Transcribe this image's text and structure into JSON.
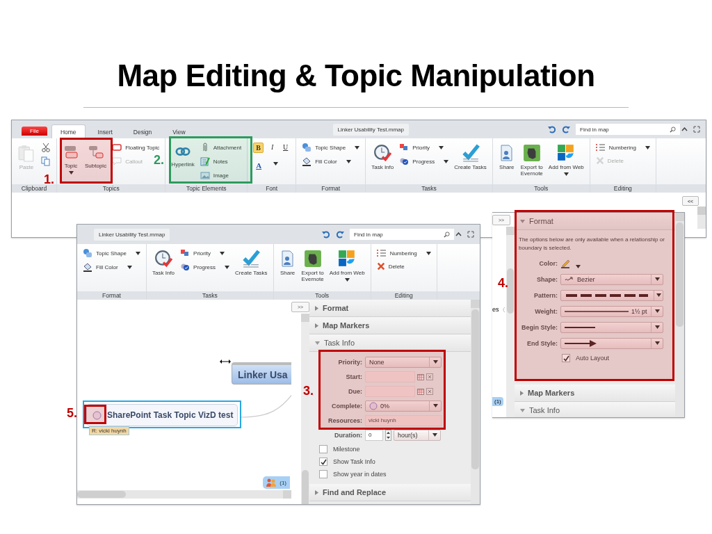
{
  "title": "Map Editing & Topic Manipulation",
  "ribbon_window": {
    "tabs": [
      {
        "label": "File",
        "kind": "file",
        "selected": false
      },
      {
        "label": "Home",
        "kind": "tab",
        "selected": true
      },
      {
        "label": "Insert",
        "kind": "tab",
        "selected": false
      },
      {
        "label": "Design",
        "kind": "tab",
        "selected": false
      },
      {
        "label": "View",
        "kind": "tab",
        "selected": false
      }
    ],
    "document_tab": "Linker Usability Test.mmap",
    "search": {
      "placeholder": "Find in map"
    },
    "groups": [
      {
        "label": "Clipboard",
        "commands": [
          {
            "kind": "large",
            "label": "Paste",
            "disabled": true
          },
          {
            "kind": "icon"
          },
          {
            "kind": "icon"
          }
        ]
      },
      {
        "label": "Topics",
        "commands": [
          {
            "kind": "large",
            "label": "Topic",
            "dropdown": true
          },
          {
            "kind": "large",
            "label": "Subtopic"
          },
          {
            "kind": "small",
            "label": "Floating Topic"
          },
          {
            "kind": "small",
            "label": "Callout",
            "disabled": true
          }
        ]
      },
      {
        "label": "Topic Elements",
        "commands": [
          {
            "kind": "large",
            "label": "Hyperlink"
          },
          {
            "kind": "small",
            "label": "Attachment"
          },
          {
            "kind": "small",
            "label": "Notes"
          },
          {
            "kind": "small",
            "label": "Image"
          }
        ]
      },
      {
        "label": "Font",
        "commands": [
          {
            "kind": "toggle",
            "label": "B",
            "on": true
          },
          {
            "kind": "toggle",
            "label": "I",
            "on": false
          },
          {
            "kind": "toggle",
            "label": "U",
            "on": false
          },
          {
            "kind": "color",
            "label": "A",
            "dropdown": true
          }
        ]
      },
      {
        "label": "Format",
        "commands": [
          {
            "kind": "small",
            "label": "Topic Shape",
            "dropdown": true
          },
          {
            "kind": "small",
            "label": "Fill Color",
            "dropdown": true
          }
        ]
      },
      {
        "label": "Tasks",
        "commands": [
          {
            "kind": "large",
            "label": "Task Info"
          },
          {
            "kind": "small",
            "label": "Priority",
            "dropdown": true
          },
          {
            "kind": "small",
            "label": "Progress",
            "dropdown": true
          },
          {
            "kind": "large",
            "label": "Create Tasks"
          }
        ]
      },
      {
        "label": "Tools",
        "commands": [
          {
            "kind": "large",
            "label": "Share"
          },
          {
            "kind": "large",
            "label": "Export to Evernote"
          },
          {
            "kind": "large",
            "label": "Add from Web",
            "dropdown": true
          }
        ]
      },
      {
        "label": "Editing",
        "commands": [
          {
            "kind": "small",
            "label": "Numbering",
            "dropdown": true
          },
          {
            "kind": "small",
            "label": "Delete",
            "disabled": true
          }
        ]
      }
    ],
    "pane_button": "<<"
  },
  "map_window": {
    "document_tab": "Linker Usability Test.mmap",
    "search": {
      "placeholder": "Find in map"
    },
    "groups": [
      {
        "label": "Format",
        "commands": [
          {
            "kind": "small",
            "label": "Topic Shape",
            "dropdown": true
          },
          {
            "kind": "small",
            "label": "Fill Color",
            "dropdown": true
          }
        ]
      },
      {
        "label": "Tasks",
        "commands": [
          {
            "kind": "large",
            "label": "Task Info"
          },
          {
            "kind": "small",
            "label": "Priority",
            "dropdown": true
          },
          {
            "kind": "small",
            "label": "Progress",
            "dropdown": true
          },
          {
            "kind": "large",
            "label": "Create Tasks"
          }
        ]
      },
      {
        "label": "Tools",
        "commands": [
          {
            "kind": "large",
            "label": "Share"
          },
          {
            "kind": "large",
            "label": "Export to Evernote"
          },
          {
            "kind": "large",
            "label": "Add from Web",
            "dropdown": true
          }
        ]
      },
      {
        "label": "Editing",
        "commands": [
          {
            "kind": "small",
            "label": "Numbering",
            "dropdown": true
          },
          {
            "kind": "small",
            "label": "Delete",
            "disabled": false
          }
        ]
      }
    ],
    "map": {
      "central_topic": "Linker Usa",
      "topic": {
        "label": "SharePoint Task Topic VizD test",
        "selected": true
      },
      "tag": "R: vicki huynh",
      "badge": "(1)"
    },
    "pane": {
      "toggle_button": ">>",
      "sections": [
        {
          "title": "Format",
          "expanded": false
        },
        {
          "title": "Map Markers",
          "expanded": false
        },
        {
          "title": "Task Info",
          "expanded": true,
          "fields": [
            {
              "kind": "dropdown",
              "label": "Priority:",
              "value": "None"
            },
            {
              "kind": "date",
              "label": "Start:"
            },
            {
              "kind": "date",
              "label": "Due:"
            },
            {
              "kind": "progress",
              "label": "Complete:",
              "value": "0%"
            },
            {
              "kind": "text",
              "label": "Resources:",
              "value": "vicki huynh"
            },
            {
              "kind": "duration",
              "label": "Duration:",
              "value": "0",
              "unit": "hour(s)"
            }
          ],
          "options": [
            {
              "label": "Milestone",
              "checked": false
            },
            {
              "label": "Show Task Info",
              "checked": true
            },
            {
              "label": "Show year in dates",
              "checked": false
            }
          ]
        },
        {
          "title": "Find and Replace",
          "expanded": false
        }
      ]
    }
  },
  "format_window": {
    "side_text": "es",
    "badge": "(1)",
    "pane": {
      "toggle_button": ">>",
      "sections": [
        {
          "title": "Format",
          "expanded": true,
          "note": "The options below are only available when a relationship or boundary is selected.",
          "fields": [
            {
              "kind": "color",
              "label": "Color:"
            },
            {
              "kind": "shape",
              "label": "Shape:",
              "value": "Bezier"
            },
            {
              "kind": "pattern",
              "label": "Pattern:"
            },
            {
              "kind": "weight",
              "label": "Weight:",
              "value": "1½ pt"
            },
            {
              "kind": "line",
              "label": "Begin Style:"
            },
            {
              "kind": "arrow",
              "label": "End Style:"
            }
          ],
          "options": [
            {
              "label": "Auto Layout",
              "checked": true
            }
          ]
        },
        {
          "title": "Map Markers",
          "expanded": false
        },
        {
          "title": "Task Info",
          "expanded": true
        }
      ]
    }
  },
  "annotations": [
    {
      "number": "1.",
      "color": "#c00000"
    },
    {
      "number": "2.",
      "color": "#2e9a5e"
    },
    {
      "number": "3.",
      "color": "#c00000"
    },
    {
      "number": "4.",
      "color": "#c00000"
    },
    {
      "number": "5.",
      "color": "#c00000"
    }
  ]
}
